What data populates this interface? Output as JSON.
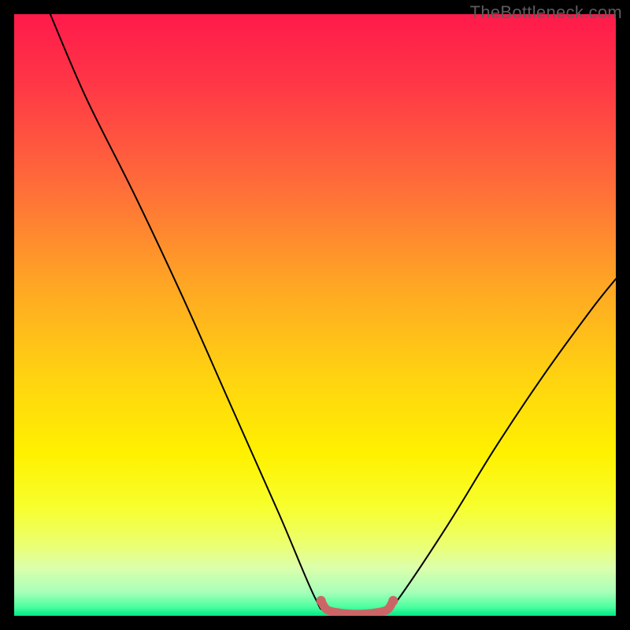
{
  "watermark": "TheBottleneck.com",
  "gradient": {
    "stops": [
      {
        "offset": 0.0,
        "color": "#ff1a4b"
      },
      {
        "offset": 0.12,
        "color": "#ff3846"
      },
      {
        "offset": 0.28,
        "color": "#ff6b3a"
      },
      {
        "offset": 0.45,
        "color": "#ffa624"
      },
      {
        "offset": 0.6,
        "color": "#ffd211"
      },
      {
        "offset": 0.73,
        "color": "#fff100"
      },
      {
        "offset": 0.82,
        "color": "#f7ff2e"
      },
      {
        "offset": 0.88,
        "color": "#ecff6f"
      },
      {
        "offset": 0.92,
        "color": "#dcffac"
      },
      {
        "offset": 0.96,
        "color": "#a9ffb9"
      },
      {
        "offset": 0.985,
        "color": "#4dffa0"
      },
      {
        "offset": 1.0,
        "color": "#00e884"
      }
    ]
  },
  "chart_data": {
    "type": "line",
    "title": "",
    "xlabel": "",
    "ylabel": "",
    "xlim": [
      0,
      100
    ],
    "ylim": [
      0,
      100
    ],
    "series": [
      {
        "name": "bottleneck-curve",
        "color": "#000000",
        "points": [
          {
            "x": 6,
            "y": 100
          },
          {
            "x": 12,
            "y": 86
          },
          {
            "x": 20,
            "y": 70
          },
          {
            "x": 28,
            "y": 53
          },
          {
            "x": 36,
            "y": 35
          },
          {
            "x": 44,
            "y": 17
          },
          {
            "x": 50,
            "y": 3
          },
          {
            "x": 52,
            "y": 1
          },
          {
            "x": 58,
            "y": 0.5
          },
          {
            "x": 62,
            "y": 1
          },
          {
            "x": 64,
            "y": 3
          },
          {
            "x": 72,
            "y": 15
          },
          {
            "x": 80,
            "y": 28
          },
          {
            "x": 88,
            "y": 40
          },
          {
            "x": 96,
            "y": 51
          },
          {
            "x": 100,
            "y": 56
          }
        ]
      },
      {
        "name": "optimal-band",
        "color": "#cc6666",
        "points": [
          {
            "x": 51,
            "y": 2.5
          },
          {
            "x": 52,
            "y": 1.0
          },
          {
            "x": 54,
            "y": 0.5
          },
          {
            "x": 56,
            "y": 0.3
          },
          {
            "x": 58,
            "y": 0.3
          },
          {
            "x": 60,
            "y": 0.5
          },
          {
            "x": 62,
            "y": 1.0
          },
          {
            "x": 63,
            "y": 2.5
          }
        ]
      }
    ]
  }
}
